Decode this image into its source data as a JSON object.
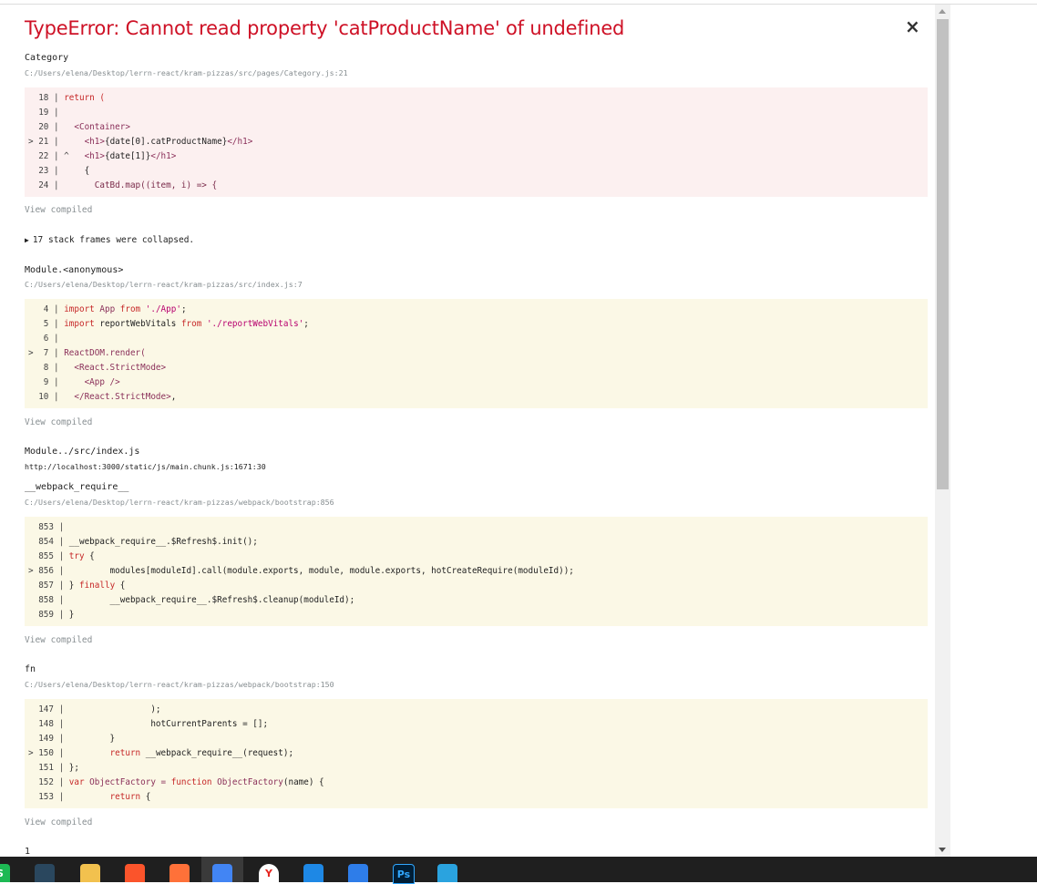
{
  "error": {
    "title": "TypeError: Cannot read property 'catProductName' of undefined",
    "close_label": "×"
  },
  "frames": [
    {
      "name": "Category",
      "path": "C:/Users/elena/Desktop/lerrn-react/kram-pizzas/src/pages/Category.js:21",
      "lines": [
        {
          "gutter": "  18 | ",
          "segments": [
            {
              "t": "return (",
              "c": "kw"
            }
          ]
        },
        {
          "gutter": "  19 | ",
          "segments": []
        },
        {
          "gutter": "  20 | ",
          "segments": [
            {
              "t": "  <Container>",
              "c": "tag"
            }
          ]
        },
        {
          "gutter": "> 21 | ",
          "segments": [
            {
              "t": "    <h1>",
              "c": "tag"
            },
            {
              "t": "{date[0].catProductName}",
              "c": ""
            },
            {
              "t": "</h1>",
              "c": "tag"
            }
          ]
        },
        {
          "gutter": "  22 | ^",
          "segments": [
            {
              "t": "   <h1>",
              "c": "tag"
            },
            {
              "t": "{date[1]}",
              "c": ""
            },
            {
              "t": "</h1>",
              "c": "tag"
            }
          ]
        },
        {
          "gutter": "  23 | ",
          "segments": [
            {
              "t": "    {",
              "c": ""
            }
          ]
        },
        {
          "gutter": "  24 | ",
          "segments": [
            {
              "t": "      CatBd.map((item, i) => {",
              "c": "fn"
            }
          ]
        }
      ]
    },
    {
      "name": "Module.<anonymous>",
      "path": "C:/Users/elena/Desktop/lerrn-react/kram-pizzas/src/index.js:7",
      "lines": [
        {
          "gutter": "   4 | ",
          "segments": [
            {
              "t": "import ",
              "c": "kw"
            },
            {
              "t": "App ",
              "c": "ident"
            },
            {
              "t": "from ",
              "c": "kw"
            },
            {
              "t": "'./App'",
              "c": "str"
            },
            {
              "t": ";",
              "c": ""
            }
          ]
        },
        {
          "gutter": "   5 | ",
          "segments": [
            {
              "t": "import ",
              "c": "kw"
            },
            {
              "t": "reportWebVitals ",
              "c": ""
            },
            {
              "t": "from ",
              "c": "kw"
            },
            {
              "t": "'./reportWebVitals'",
              "c": "str"
            },
            {
              "t": ";",
              "c": ""
            }
          ]
        },
        {
          "gutter": "   6 | ",
          "segments": []
        },
        {
          "gutter": ">  7 | ",
          "segments": [
            {
              "t": "ReactDOM.render(",
              "c": "ident"
            }
          ]
        },
        {
          "gutter": "   8 | ",
          "segments": [
            {
              "t": "  <React.StrictMode>",
              "c": "tag"
            }
          ]
        },
        {
          "gutter": "   9 | ",
          "segments": [
            {
              "t": "    <App />",
              "c": "tag"
            }
          ]
        },
        {
          "gutter": "  10 | ",
          "segments": [
            {
              "t": "  </React.StrictMode>",
              "c": "tag"
            },
            {
              "t": ",",
              "c": ""
            }
          ]
        }
      ]
    },
    {
      "name": "Module../src/index.js",
      "path": "http://localhost:3000/static/js/main.chunk.js:1671:30"
    },
    {
      "name": "__webpack_require__",
      "path": "C:/Users/elena/Desktop/lerrn-react/kram-pizzas/webpack/bootstrap:856",
      "lines": [
        {
          "gutter": "  853 | ",
          "segments": []
        },
        {
          "gutter": "  854 | ",
          "segments": [
            {
              "t": "__webpack_require__.$Refresh$.init();",
              "c": ""
            }
          ]
        },
        {
          "gutter": "  855 | ",
          "segments": [
            {
              "t": "try ",
              "c": "kw"
            },
            {
              "t": "{",
              "c": ""
            }
          ]
        },
        {
          "gutter": "> 856 | ",
          "segments": [
            {
              "t": "        modules[moduleId].call(module.exports, module, module.exports, hotCreateRequire(moduleId));",
              "c": ""
            }
          ]
        },
        {
          "gutter": "  857 | ",
          "segments": [
            {
              "t": "} ",
              "c": ""
            },
            {
              "t": "finally ",
              "c": "kw"
            },
            {
              "t": "{",
              "c": ""
            }
          ]
        },
        {
          "gutter": "  858 | ",
          "segments": [
            {
              "t": "        __webpack_require__.$Refresh$.cleanup(moduleId);",
              "c": ""
            }
          ]
        },
        {
          "gutter": "  859 | ",
          "segments": [
            {
              "t": "}",
              "c": ""
            }
          ]
        }
      ]
    },
    {
      "name": "fn",
      "path": "C:/Users/elena/Desktop/lerrn-react/kram-pizzas/webpack/bootstrap:150",
      "lines": [
        {
          "gutter": "  147 | ",
          "segments": [
            {
              "t": "                );",
              "c": ""
            }
          ]
        },
        {
          "gutter": "  148 | ",
          "segments": [
            {
              "t": "                hotCurrentParents = [];",
              "c": ""
            }
          ]
        },
        {
          "gutter": "  149 | ",
          "segments": [
            {
              "t": "        }",
              "c": ""
            }
          ]
        },
        {
          "gutter": "> 150 | ",
          "segments": [
            {
              "t": "        ",
              "c": ""
            },
            {
              "t": "return ",
              "c": "kw"
            },
            {
              "t": "__webpack_require__(request);",
              "c": ""
            }
          ]
        },
        {
          "gutter": "  151 | ",
          "segments": [
            {
              "t": "};",
              "c": ""
            }
          ]
        },
        {
          "gutter": "  152 | ",
          "segments": [
            {
              "t": "var ",
              "c": "kw"
            },
            {
              "t": "ObjectFactory = ",
              "c": "ident"
            },
            {
              "t": "function ",
              "c": "kw"
            },
            {
              "t": "ObjectFactory",
              "c": "ident"
            },
            {
              "t": "(name) {",
              "c": ""
            }
          ]
        },
        {
          "gutter": "  153 | ",
          "segments": [
            {
              "t": "        ",
              "c": ""
            },
            {
              "t": "return ",
              "c": "kw"
            },
            {
              "t": "{",
              "c": ""
            }
          ]
        }
      ]
    }
  ],
  "view_compiled_label": "View compiled",
  "collapsed_frames_label": "17 stack frames were collapsed.",
  "collapsed_toggle_icon": "▶",
  "bottom_cut_text": "1",
  "taskbar": {
    "icons": [
      {
        "name": "s-app-icon",
        "label": "S",
        "color": "#1db954"
      },
      {
        "name": "steam-icon",
        "label": "",
        "color": "#2a475e"
      },
      {
        "name": "file-explorer-icon",
        "label": "",
        "color": "#f2c14e"
      },
      {
        "name": "brave-icon",
        "label": "",
        "color": "#fb542b"
      },
      {
        "name": "firefox-icon",
        "label": "",
        "color": "#ff7139"
      },
      {
        "name": "chrome-icon",
        "label": "",
        "color": "#4285f4"
      },
      {
        "name": "yandex-icon",
        "label": "Y",
        "color": "#ffffff"
      },
      {
        "name": "vscode-icon",
        "label": "",
        "color": "#1e88e5"
      },
      {
        "name": "todo-icon",
        "label": "",
        "color": "#2e7de9"
      },
      {
        "name": "photoshop-icon",
        "label": "Ps",
        "color": "#001e36"
      },
      {
        "name": "telegram-icon",
        "label": "",
        "color": "#2aa3df"
      }
    ]
  }
}
